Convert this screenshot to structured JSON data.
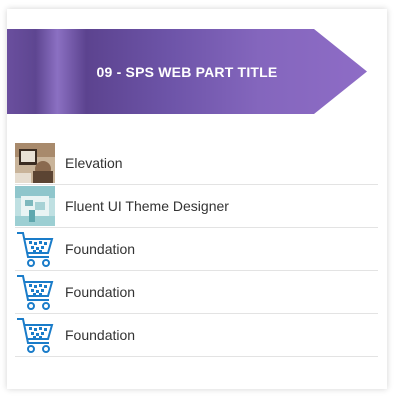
{
  "webpart": {
    "title": "09 - SPS WEB PART TITLE",
    "banner_colors": [
      "#5b4593",
      "#7d5cb5",
      "#8f6dc6"
    ]
  },
  "links": [
    {
      "label": "Elevation",
      "icon": "elevation-thumbnail-icon"
    },
    {
      "label": "Fluent UI Theme Designer",
      "icon": "fluent-ui-thumbnail-icon"
    },
    {
      "label": "Foundation",
      "icon": "shopping-cart-icon"
    },
    {
      "label": "Foundation",
      "icon": "shopping-cart-icon"
    },
    {
      "label": "Foundation",
      "icon": "shopping-cart-icon"
    }
  ],
  "colors": {
    "cart_blue": "#1a7cc9",
    "divider": "#e3e3e3",
    "text": "#333333"
  }
}
